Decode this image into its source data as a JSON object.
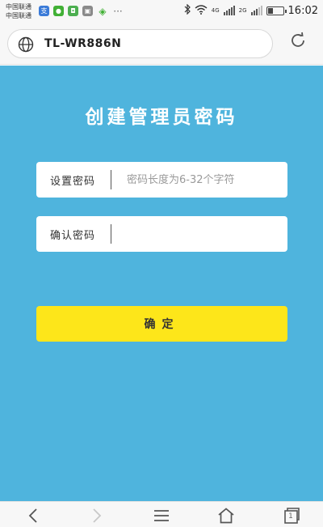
{
  "status_bar": {
    "carrier_1": "中国联通",
    "carrier_2": "中国联通",
    "network_1": "4G",
    "network_2": "2G",
    "time": "16:02",
    "more": "···",
    "notification_icons": [
      "alipay-icon",
      "wechat-icon",
      "chat-icon",
      "image-icon",
      "wifi-share-icon"
    ]
  },
  "browser": {
    "url": "TL-WR886N"
  },
  "page": {
    "title": "创建管理员密码",
    "set_password_label": "设置密码",
    "set_password_placeholder": "密码长度为6-32个字符",
    "set_password_value": "",
    "confirm_password_label": "确认密码",
    "confirm_password_placeholder": "",
    "confirm_password_value": "",
    "confirm_button": "确定"
  },
  "colors": {
    "main_bg": "#4fb4dd",
    "button_bg": "#fde61a",
    "field_bg": "#ffffff"
  },
  "bottom_nav": {
    "items": [
      "back-icon",
      "forward-icon",
      "menu-icon",
      "home-icon",
      "tabs-icon"
    ],
    "tab_count": "1"
  }
}
